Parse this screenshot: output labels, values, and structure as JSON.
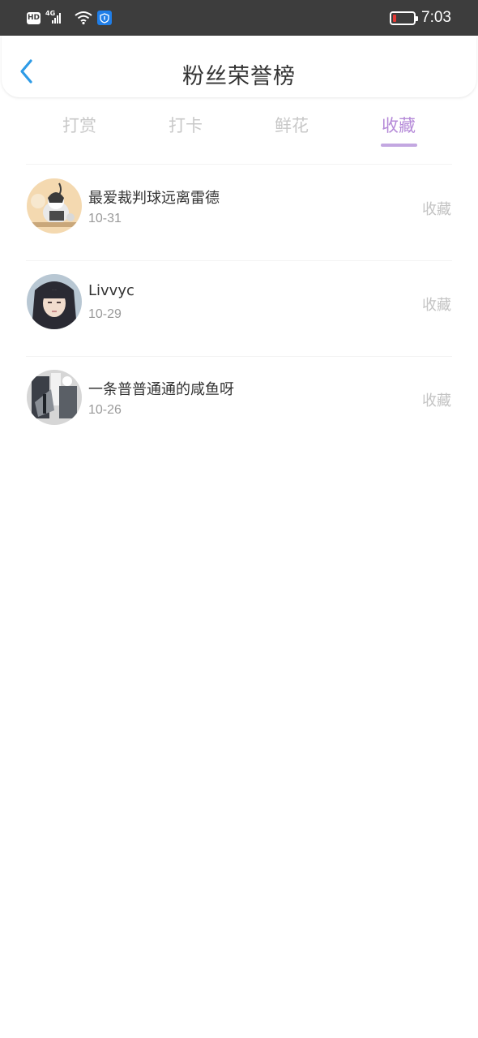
{
  "status_bar": {
    "hd": "HD",
    "network": "4G",
    "time": "7:03"
  },
  "header": {
    "title": "粉丝荣誉榜"
  },
  "tabs": [
    {
      "label": "打赏",
      "active": false
    },
    {
      "label": "打卡",
      "active": false
    },
    {
      "label": "鲜花",
      "active": false
    },
    {
      "label": "收藏",
      "active": true
    }
  ],
  "list": [
    {
      "name": "最爱裁判球远离雷德",
      "date": "10-31",
      "action": "收藏",
      "avatar": "user-avatar"
    },
    {
      "name": "Livvyc",
      "date": "10-29",
      "action": "收藏",
      "avatar": "user-avatar"
    },
    {
      "name": "一条普普通通的咸鱼呀",
      "date": "10-26",
      "action": "收藏",
      "avatar": "user-avatar"
    }
  ],
  "colors": {
    "status_bar": "#3d3d3d",
    "accent": "#b58ad8",
    "back_arrow": "#2e9be6",
    "muted": "#c3c3c3"
  }
}
